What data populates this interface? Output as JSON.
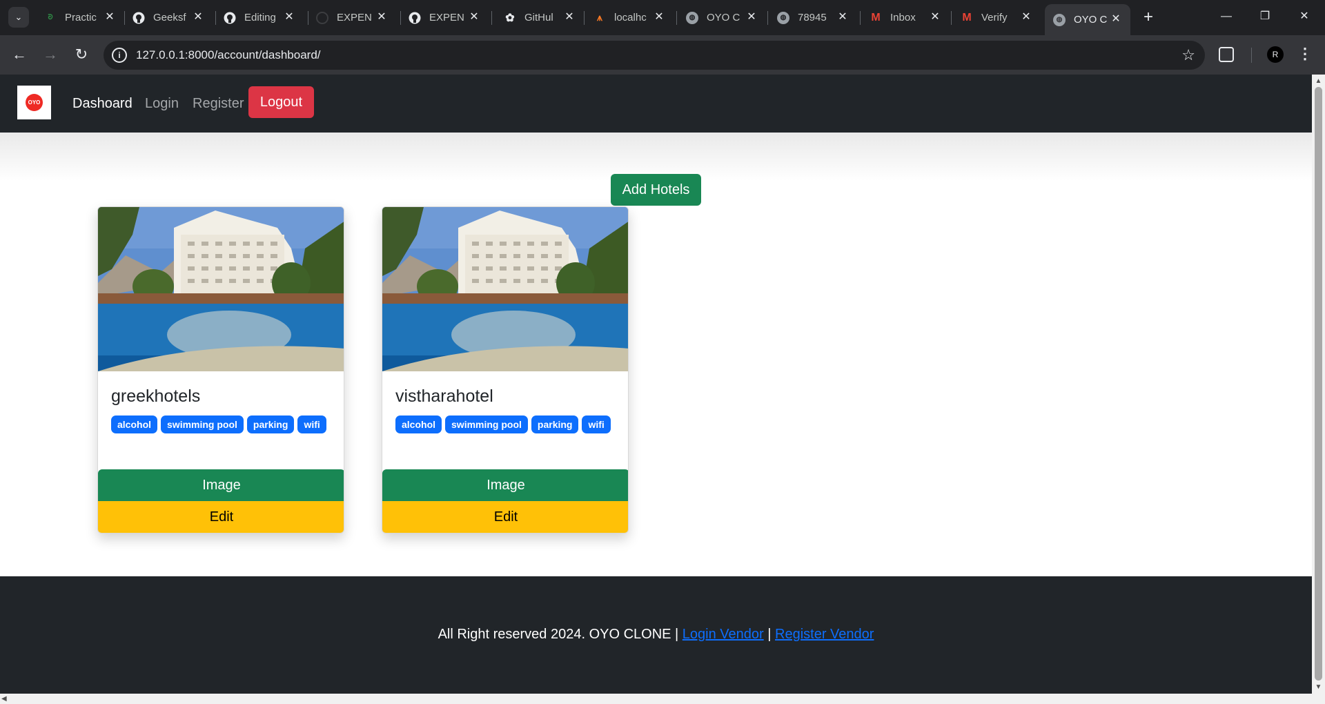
{
  "browser": {
    "tabs": [
      {
        "title": "Practic",
        "icon": "gfg-icon",
        "icon_color": "#2f8d46"
      },
      {
        "title": "Geeksf",
        "icon": "github-icon",
        "icon_color": "#e8eaed"
      },
      {
        "title": "Editing",
        "icon": "github-icon",
        "icon_color": "#e8eaed"
      },
      {
        "title": "EXPEN",
        "icon": "loading-icon",
        "icon_color": "#5f6368"
      },
      {
        "title": "EXPEN",
        "icon": "github-icon",
        "icon_color": "#e8eaed"
      },
      {
        "title": "GitHul",
        "icon": "openai-icon",
        "icon_color": "#e8eaed"
      },
      {
        "title": "localhc",
        "icon": "xampp-icon",
        "icon_color": "#fb7a24"
      },
      {
        "title": "OYO C",
        "icon": "globe-icon",
        "icon_color": "#9aa0a6"
      },
      {
        "title": "78945",
        "icon": "globe-icon",
        "icon_color": "#9aa0a6"
      },
      {
        "title": "Inbox",
        "icon": "gmail-icon",
        "icon_color": "#ea4335"
      },
      {
        "title": "Verify",
        "icon": "gmail-icon",
        "icon_color": "#ea4335"
      },
      {
        "title": "OYO C",
        "icon": "globe-icon",
        "icon_color": "#9aa0a6",
        "active": true
      }
    ],
    "url": "127.0.0.1:8000/account/dashboard/",
    "profile_initial": "R"
  },
  "navbar": {
    "brand_text": "OYO",
    "links": [
      "Dashoard",
      "Login",
      "Register"
    ],
    "logout_label": "Logout"
  },
  "add_hotels_label": "Add Hotels",
  "hotels": [
    {
      "name": "greekhotels",
      "amenities": [
        "alcohol",
        "swimming pool",
        "parking",
        "wifi"
      ],
      "image_label": "Image",
      "edit_label": "Edit"
    },
    {
      "name": "vistharahotel",
      "amenities": [
        "alcohol",
        "swimming pool",
        "parking",
        "wifi"
      ],
      "image_label": "Image",
      "edit_label": "Edit"
    }
  ],
  "footer": {
    "text": "All Right reserved 2024. OYO CLONE |",
    "login_vendor": "Login Vendor",
    "separator": "|",
    "register_vendor": "Register Vendor"
  },
  "colors": {
    "navbar_bg": "#212529",
    "danger": "#dc3545",
    "success": "#198754",
    "warning": "#ffc107",
    "primary": "#0d6efd"
  }
}
